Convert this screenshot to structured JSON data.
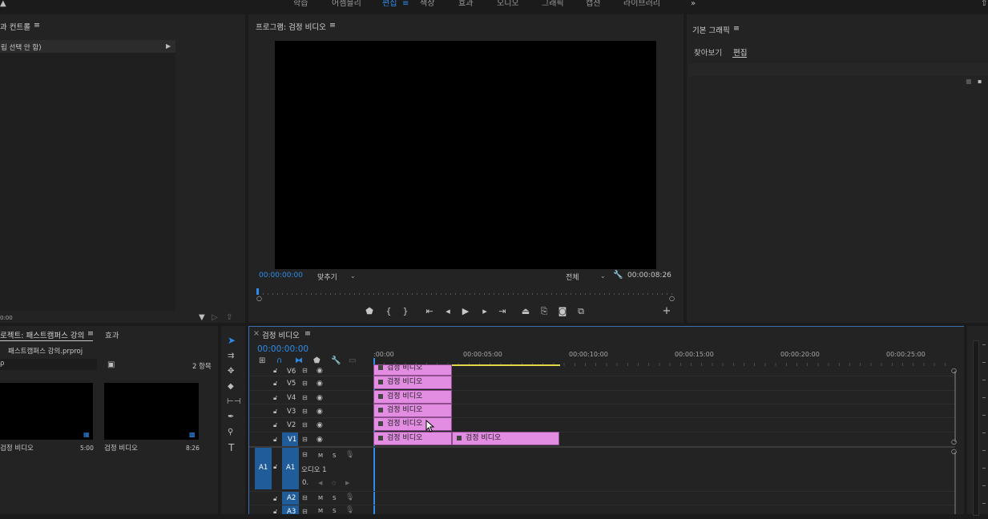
{
  "workspace_tabs": [
    "학습",
    "어셈블리",
    "편집",
    "색상",
    "효과",
    "오디오",
    "그래픽",
    "캡션",
    "라이브러리"
  ],
  "active_workspace": "편집",
  "effect_controls": {
    "title": "과 컨트롤",
    "no_clip": "립 선택 안 함)",
    "timecode": "0:00"
  },
  "program_monitor": {
    "title": "프로그램: 검정 비디오",
    "timecode": "00:00:00:00",
    "fit": "맞추기",
    "quality": "전체",
    "duration": "00:00:08:26"
  },
  "essential_graphics": {
    "title": "기본 그래픽",
    "tabs": [
      "찾아보기",
      "편집"
    ],
    "active_tab": "편집"
  },
  "project": {
    "title": "로젝트: 패스트캠퍼스 강의",
    "tab2": "효과",
    "file": "패스트캠퍼스 강의.prproj",
    "search_prefix": "ρ",
    "count": "2 항목",
    "items": [
      {
        "name": "검정 비디오",
        "duration": "5:00"
      },
      {
        "name": "검정 비디오",
        "duration": "8:26"
      }
    ]
  },
  "timeline": {
    "title": "검정 비디오",
    "timecode": "00:00:00:00",
    "ruler": [
      ":00:00",
      "00:00:05:00",
      "00:00:10:00",
      "00:00:15:00",
      "00:00:20:00",
      "00:00:25:00"
    ],
    "video_tracks": [
      "V6",
      "V5",
      "V4",
      "V3",
      "V2",
      "V1"
    ],
    "audio_tracks": [
      "A1",
      "A2",
      "A3"
    ],
    "audio_name": "오디오 1",
    "audio_volume": "0.",
    "source_patch": "A1",
    "mute": "M",
    "solo": "S",
    "clip_name": "검정 비디오"
  },
  "colors": {
    "accent": "#2d8ceb",
    "clip": "#e28ce2",
    "track_target": "#1f5c99"
  }
}
